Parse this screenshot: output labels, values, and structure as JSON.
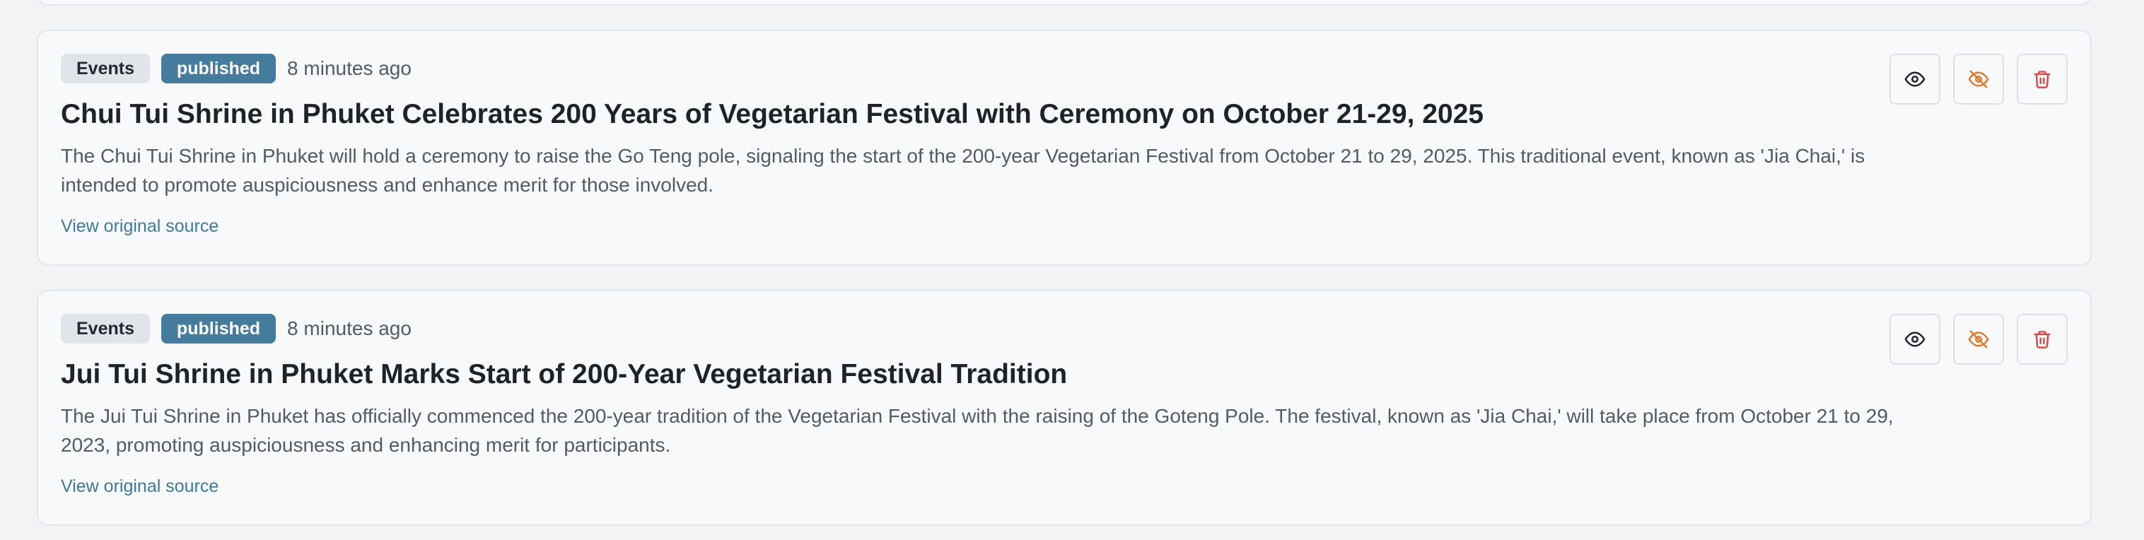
{
  "articles": [
    {
      "category": "Events",
      "status": "published",
      "time": "8 minutes ago",
      "title": "Chui Tui Shrine in Phuket Celebrates 200 Years of Vegetarian Festival with Ceremony on October 21-29, 2025",
      "summary": "The Chui Tui Shrine in Phuket will hold a ceremony to raise the Go Teng pole, signaling the start of the 200-year Vegetarian Festival from October 21 to 29, 2025. This traditional event, known as 'Jia Chai,' is intended to promote auspiciousness and enhance merit for those involved.",
      "source_link": "View original source"
    },
    {
      "category": "Events",
      "status": "published",
      "time": "8 minutes ago",
      "title": "Jui Tui Shrine in Phuket Marks Start of 200-Year Vegetarian Festival Tradition",
      "summary": "The Jui Tui Shrine in Phuket has officially commenced the 200-year tradition of the Vegetarian Festival with the raising of the Goteng Pole. The festival, known as 'Jia Chai,' will take place from October 21 to 29, 2023, promoting auspiciousness and enhancing merit for participants.",
      "source_link": "View original source"
    }
  ],
  "icons": {
    "view": "eye-icon",
    "unpublish": "eye-off-icon",
    "delete": "trash-icon"
  },
  "colors": {
    "status_badge": "#457b9d",
    "link": "#3d7a99",
    "unpublish_icon": "#e07b2a",
    "delete_icon": "#d64541"
  }
}
